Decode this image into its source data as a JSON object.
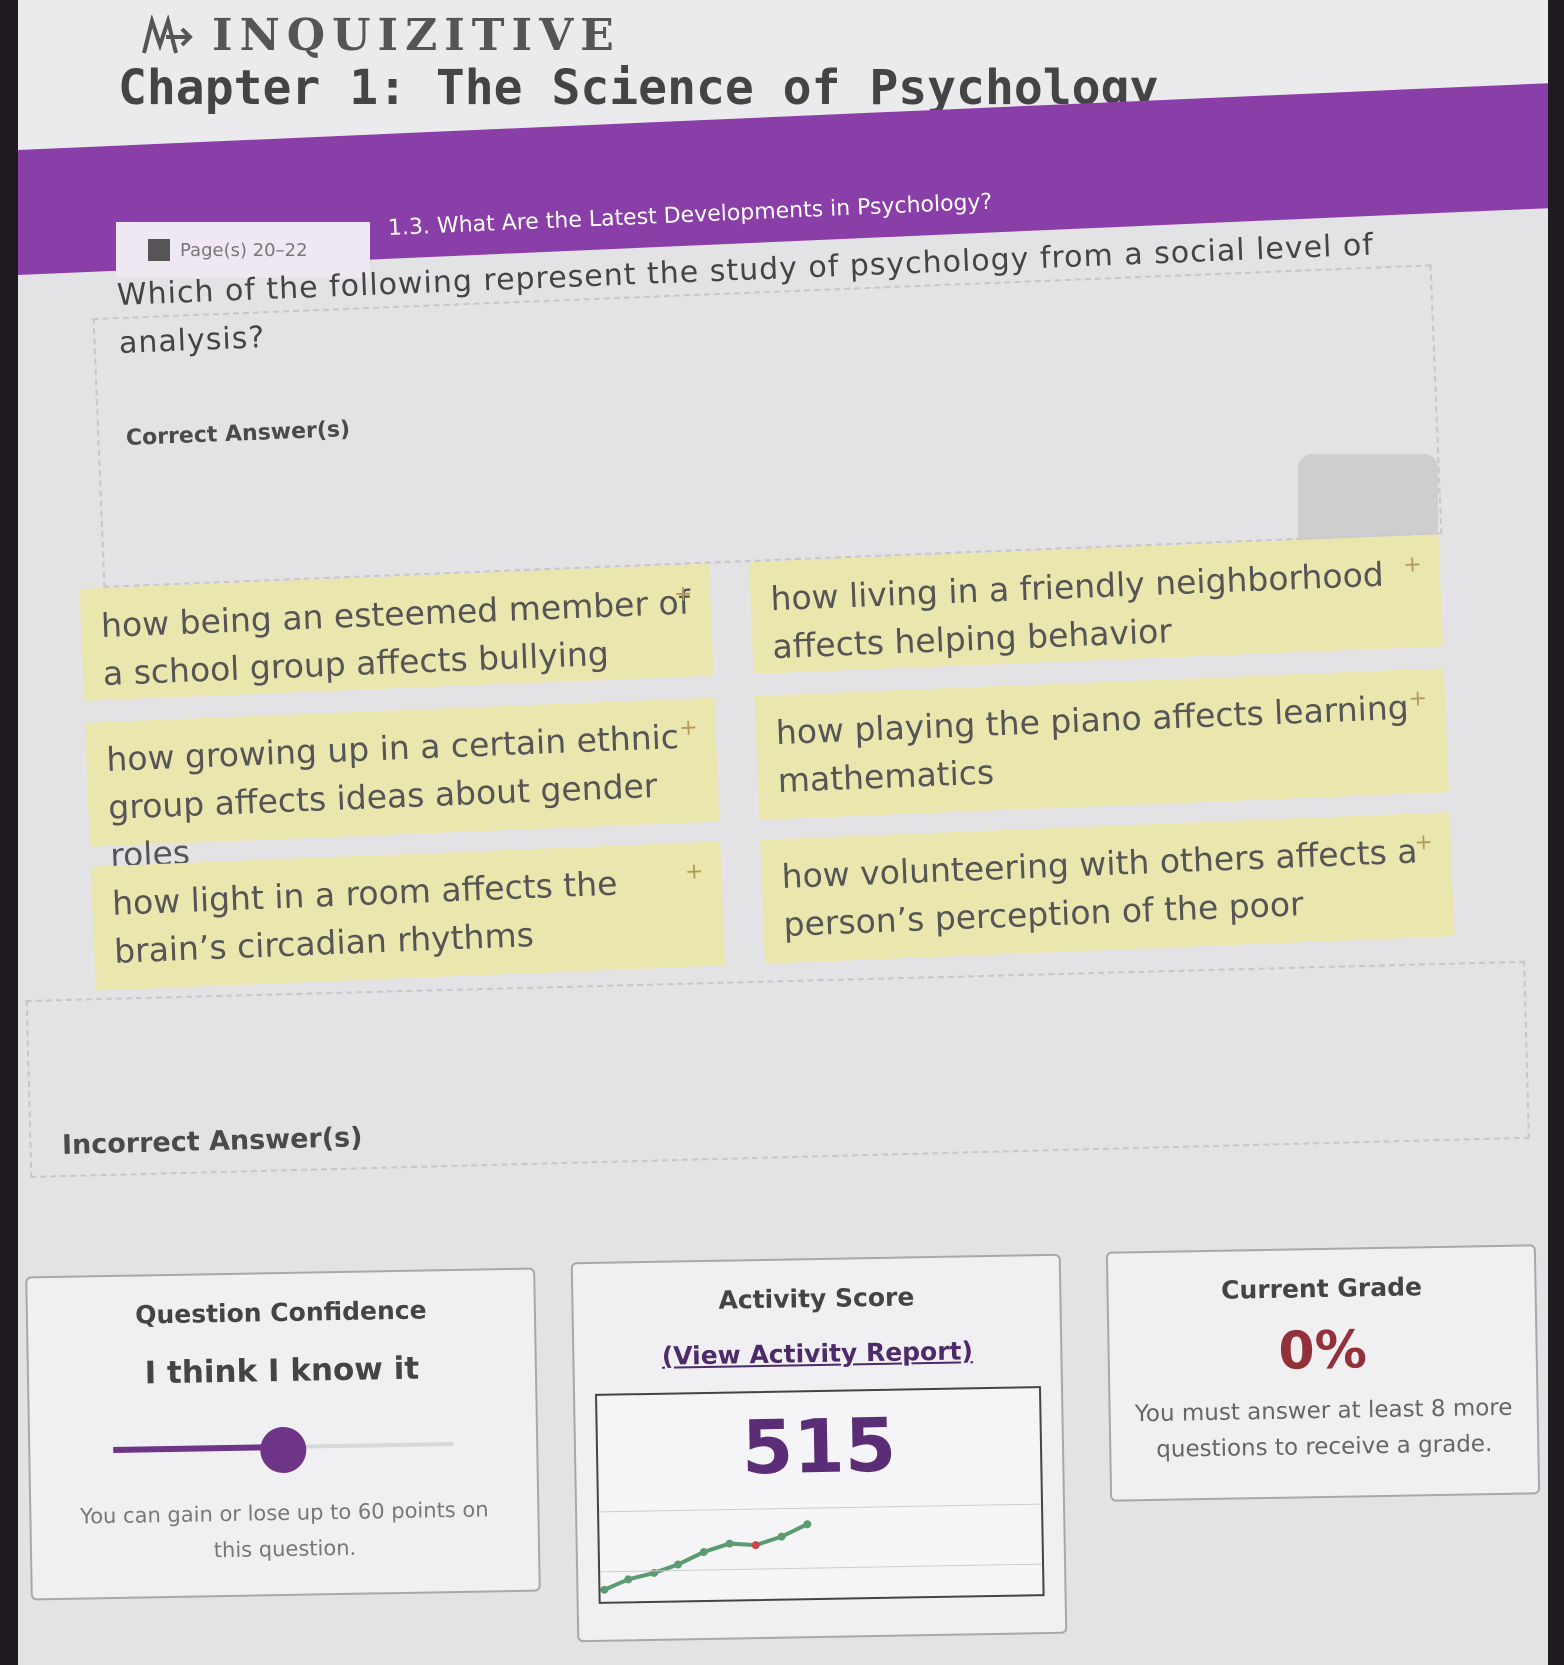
{
  "brand": {
    "logo_text": "INQUIZITIVE"
  },
  "chapter": {
    "title": "Chapter 1: The Science of Psychology"
  },
  "section": {
    "pages": "Page(s) 20–22",
    "title": "1.3. What Are the Latest Developments in Psychology?"
  },
  "question": {
    "text": "Which of the following represent the study of psychology from a social level of analysis?"
  },
  "zones": {
    "correct_label": "Correct Answer(s)",
    "incorrect_label": "Incorrect Answer(s)"
  },
  "answers": [
    {
      "text": "how being an esteemed member of a school group affects bullying"
    },
    {
      "text": "how living in a friendly neighborhood affects helping behavior"
    },
    {
      "text": "how growing up in a certain ethnic group affects ideas about gender roles"
    },
    {
      "text": "how playing the piano affects learning mathematics"
    },
    {
      "text": "how light in a room affects the brain’s circadian rhythms"
    },
    {
      "text": "how volunteering with others affects a person’s perception of the poor"
    }
  ],
  "confidence": {
    "title": "Question Confidence",
    "level": "I think I know it",
    "slider_value": 0.5,
    "note": "You can gain or lose up to 60 points on this question."
  },
  "activity": {
    "title": "Activity Score",
    "report_link": "(View Activity Report)",
    "score": "515"
  },
  "grade": {
    "title": "Current Grade",
    "value": "0%",
    "note": "You must answer at least 8 more questions to receive a grade."
  },
  "colors": {
    "accent_purple": "#8a3fa8",
    "answer_tile": "#e9e7ad",
    "grade_red": "#93313a"
  }
}
